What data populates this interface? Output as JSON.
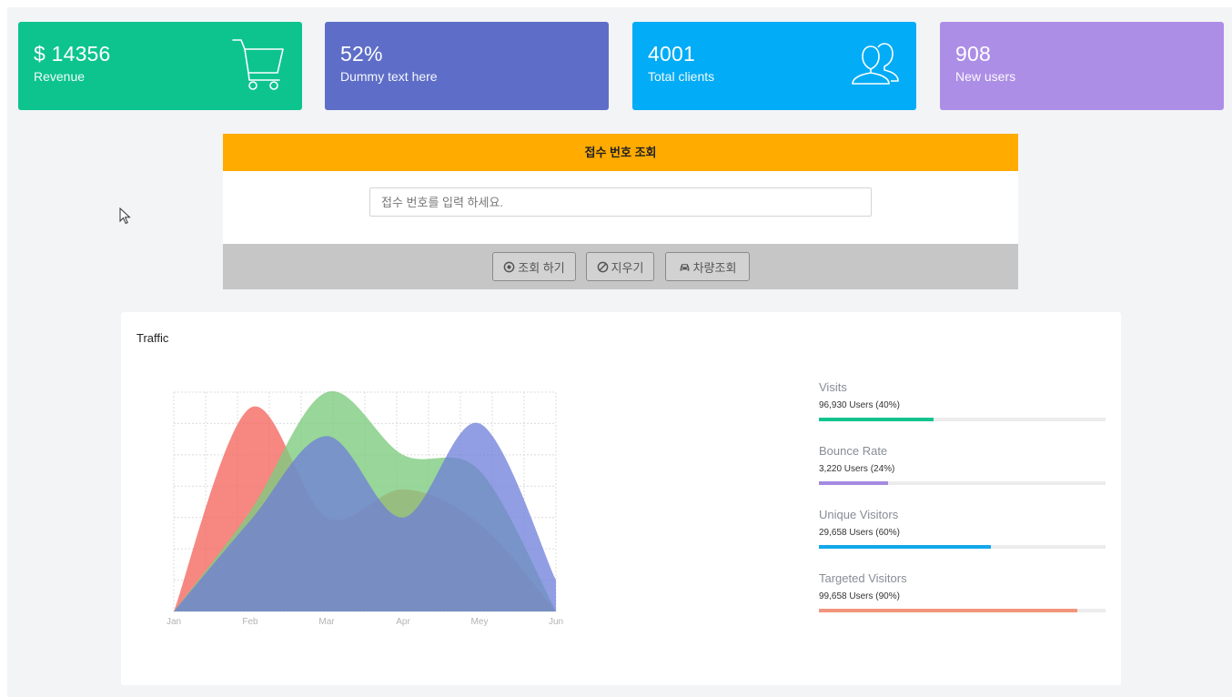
{
  "cards": [
    {
      "value": "$ 14356",
      "label": "Revenue",
      "icon": "cart-icon",
      "color": "#0dc48f"
    },
    {
      "value": "52%",
      "label": "Dummy text here",
      "icon": "",
      "color": "#5e6ec8"
    },
    {
      "value": "4001",
      "label": "Total clients",
      "icon": "users-icon",
      "color": "#02acf6"
    },
    {
      "value": "908",
      "label": "New users",
      "icon": "",
      "color": "#ad8ee6"
    }
  ],
  "lookup": {
    "title": "접수 번호 조회",
    "placeholder": "접수 번호를 입력 하세요.",
    "search_label": "조회 하기",
    "clear_label": "지우기",
    "vehicle_label": "차량조회",
    "header_color": "#ffab00"
  },
  "traffic": {
    "title": "Traffic",
    "stats": [
      {
        "title": "Visits",
        "sub": "96,930 Users (40%)",
        "pct": 40,
        "color": "#12c38f"
      },
      {
        "title": "Bounce Rate",
        "sub": "3,220 Users (24%)",
        "pct": 24,
        "color": "#a48ae0"
      },
      {
        "title": "Unique Visitors",
        "sub": "29,658 Users (60%)",
        "pct": 60,
        "color": "#12a8eb"
      },
      {
        "title": "Targeted Visitors",
        "sub": "99,658 Users (90%)",
        "pct": 90,
        "color": "#f2957c"
      }
    ]
  },
  "chart_data": {
    "type": "area",
    "categories": [
      "Jan",
      "Feb",
      "Mar",
      "Apr",
      "Mey",
      "Jun"
    ],
    "ylim": [
      0,
      7
    ],
    "grid": true,
    "series": [
      {
        "values": [
          0,
          6.5,
          3.0,
          3.9,
          2.8,
          0
        ],
        "color": "#f46a62",
        "opacity": 0.8
      },
      {
        "values": [
          0,
          3.2,
          7.0,
          5.0,
          4.5,
          0
        ],
        "color": "#7fcc7f",
        "opacity": 0.8
      },
      {
        "values": [
          0,
          2.9,
          5.6,
          3.0,
          6.0,
          1.0
        ],
        "color": "#6e7ed9",
        "opacity": 0.75
      }
    ]
  }
}
